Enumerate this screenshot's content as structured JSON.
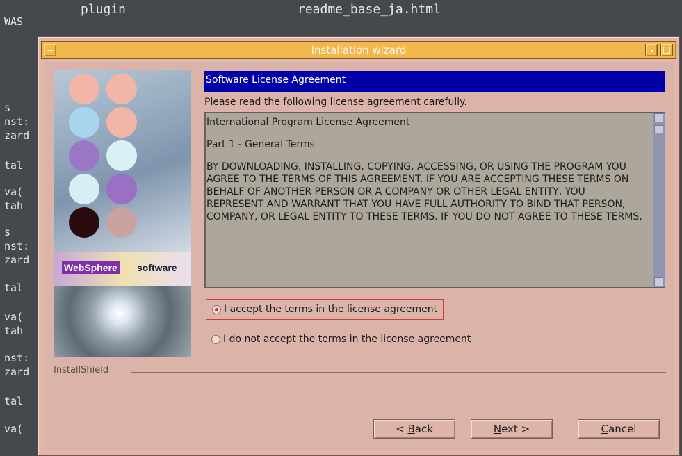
{
  "terminal": {
    "top_left": "WAS",
    "top_col1": "plugin",
    "top_col2": "readme_base_ja.html",
    "left_lines": [
      "s",
      "nst:",
      "zard",
      "tal",
      "va(",
      "tah",
      "s",
      "nst:",
      "zard",
      "tal",
      "va(",
      "tah",
      "nst:",
      "zard",
      "tal",
      "va("
    ]
  },
  "window": {
    "title": "Installation wizard"
  },
  "branding": {
    "product": "WebSphere",
    "suffix": "software",
    "circle_colors": [
      "#f2b6a8",
      "#f2b6a8",
      "#a9d6ee",
      "#f2b6a8",
      "#9b77c7",
      "#d9f0f4",
      "#d8eef4",
      "#9b6fc4",
      "#2a0c10",
      "#c9a3a2"
    ]
  },
  "content": {
    "header": "Software License Agreement",
    "instruction": "Please read the following license agreement carefully.",
    "license": {
      "title": "International Program License Agreement",
      "part": "Part 1 - General Terms",
      "body": "BY DOWNLOADING, INSTALLING, COPYING, ACCESSING, OR USING THE PROGRAM YOU AGREE TO THE TERMS OF THIS AGREEMENT. IF YOU ARE ACCEPTING THESE TERMS ON BEHALF OF ANOTHER PERSON OR A COMPANY OR OTHER LEGAL ENTITY, YOU REPRESENT AND WARRANT THAT YOU HAVE FULL AUTHORITY TO BIND THAT PERSON, COMPANY, OR LEGAL ENTITY TO THESE TERMS. IF YOU DO NOT AGREE TO THESE TERMS,"
    },
    "options": [
      {
        "label": "I accept the terms in the license agreement",
        "checked": true
      },
      {
        "label": "I do not accept the terms in the license agreement",
        "checked": false
      }
    ]
  },
  "footer": {
    "brand": "InstallShield",
    "buttons": {
      "back_prefix": "< ",
      "back_key": "B",
      "back_rest": "ack",
      "next_key": "N",
      "next_rest": "ext >",
      "cancel_key": "C",
      "cancel_rest": "ancel"
    }
  }
}
